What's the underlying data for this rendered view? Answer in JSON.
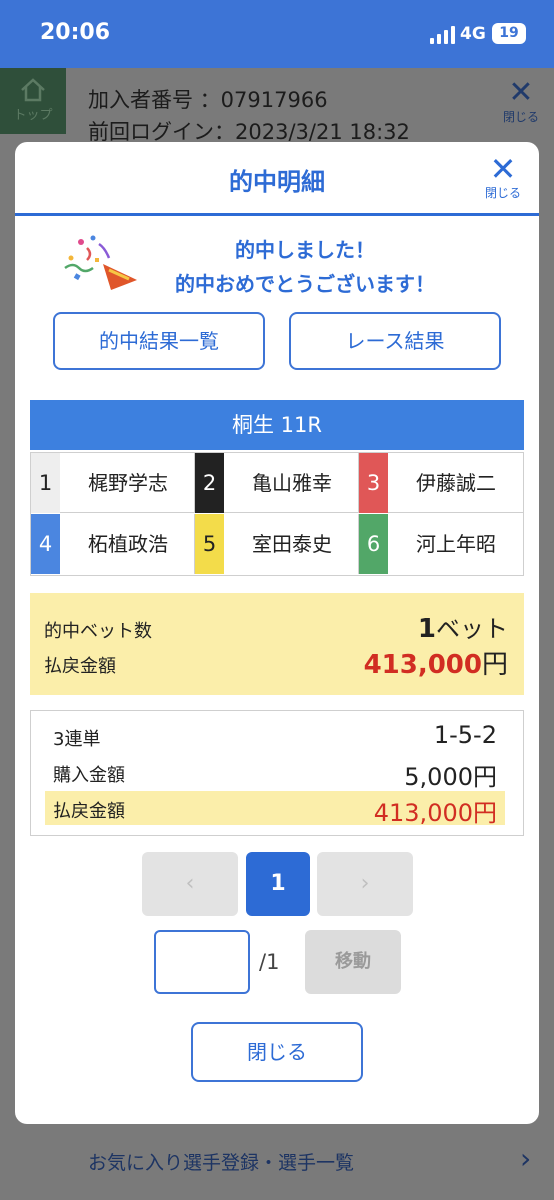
{
  "status_bar": {
    "time": "20:06",
    "network": "4G",
    "battery": "19"
  },
  "background": {
    "home_label": "トップ",
    "member_id_line": "加入者番号 ：07917966",
    "last_login_line": "前回ログイン：2023/3/21 18:32",
    "close_label": "閉じる",
    "footer_link": "お気に入り選手登録・選手一覧"
  },
  "modal": {
    "title": "的中明細",
    "close_label": "閉じる",
    "congrats_line1": "的中しました！",
    "congrats_line2": "的中おめでとうございます！",
    "results_button": "的中結果一覧",
    "race_button": "レース結果",
    "race_title": "桐生 11R",
    "racers": [
      {
        "num": "1",
        "name": "梶野学志",
        "color": "#eeeeee",
        "text_color": "#222222"
      },
      {
        "num": "2",
        "name": "亀山雅幸",
        "color": "#222222",
        "text_color": "#ffffff"
      },
      {
        "num": "3",
        "name": "伊藤誠二",
        "color": "#e05757",
        "text_color": "#ffffff"
      },
      {
        "num": "4",
        "name": "柘植政浩",
        "color": "#4b86e0",
        "text_color": "#ffffff"
      },
      {
        "num": "5",
        "name": "室田泰史",
        "color": "#f3dc4a",
        "text_color": "#222222"
      },
      {
        "num": "6",
        "name": "河上年昭",
        "color": "#52a768",
        "text_color": "#ffffff"
      }
    ],
    "summary": {
      "bets_label": "的中ベット数",
      "bets_count": "1",
      "bets_unit": "ベット",
      "payout_label": "払戻金額",
      "payout_value": "413,000",
      "payout_unit": "円"
    },
    "detail": {
      "type_label": "3連単",
      "combination": "1-5-2",
      "purchase_label": "購入金額",
      "purchase_value": "5,000円",
      "payout_label": "払戻金額",
      "payout_value": "413,000円"
    },
    "pagination": {
      "prev": "‹",
      "current": "1",
      "next": "›",
      "page_input_value": "",
      "total": "/1",
      "move_label": "移動"
    },
    "close_button": "閉じる"
  },
  "colors": {
    "primary": "#2d6bd5",
    "highlight": "#fbeeaa",
    "payout_red": "#d12d22"
  }
}
